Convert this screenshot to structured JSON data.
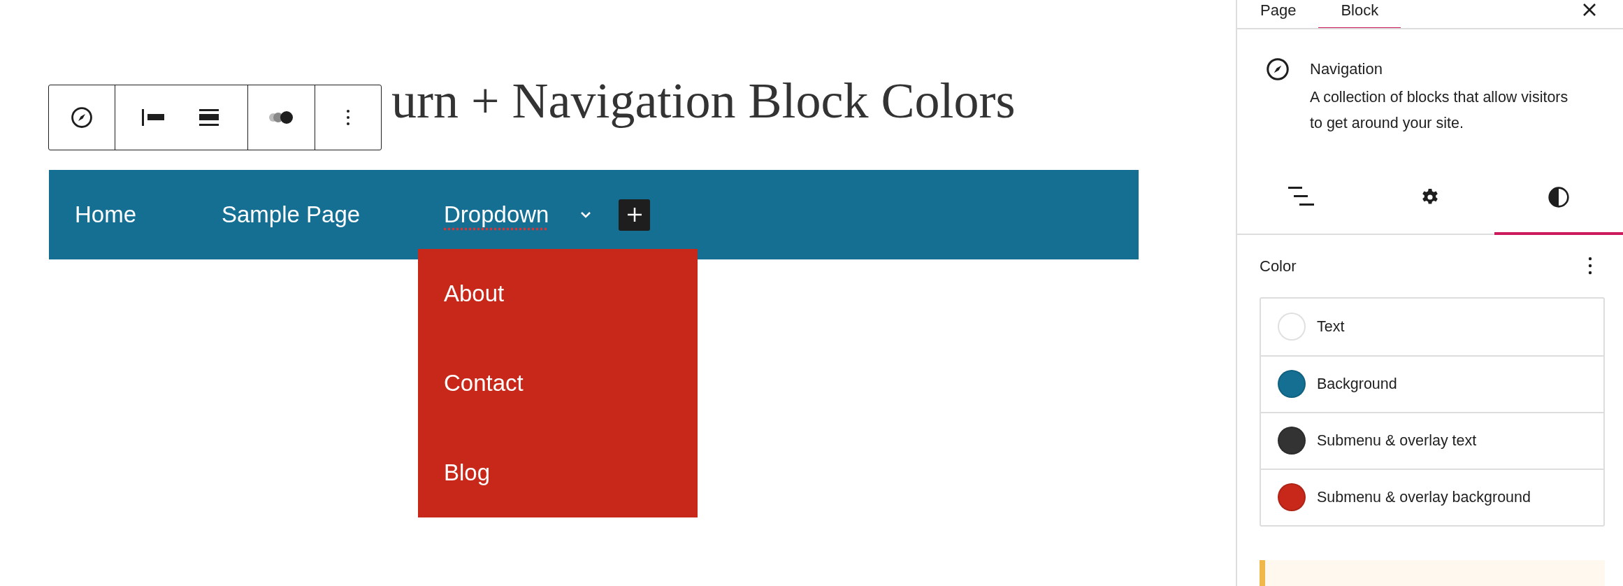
{
  "canvas": {
    "title": "urn + Navigation Block Colors",
    "navigation": {
      "items": [
        {
          "label": "Home"
        },
        {
          "label": "Sample Page"
        },
        {
          "label": "Dropdown",
          "expanded": true,
          "submenu": [
            {
              "label": "About"
            },
            {
              "label": "Contact"
            },
            {
              "label": "Blog"
            }
          ]
        }
      ]
    }
  },
  "sidebar": {
    "tabs": [
      {
        "label": "Page",
        "selected": false
      },
      {
        "label": "Block",
        "selected": true
      }
    ],
    "block": {
      "name": "Navigation",
      "description": "A collection of blocks that allow visitors to get around your site."
    },
    "inspector_tabs": [
      {
        "kind": "list",
        "selected": false
      },
      {
        "kind": "settings",
        "selected": false
      },
      {
        "kind": "styles",
        "selected": true
      }
    ],
    "color_panel": {
      "heading": "Color",
      "items": [
        {
          "label": "Text",
          "color": "#ffffff"
        },
        {
          "label": "Background",
          "color": "#146f92"
        },
        {
          "label": "Submenu & overlay text",
          "color": "#333333"
        },
        {
          "label": "Submenu & overlay background",
          "color": "#c8281a"
        }
      ]
    }
  }
}
